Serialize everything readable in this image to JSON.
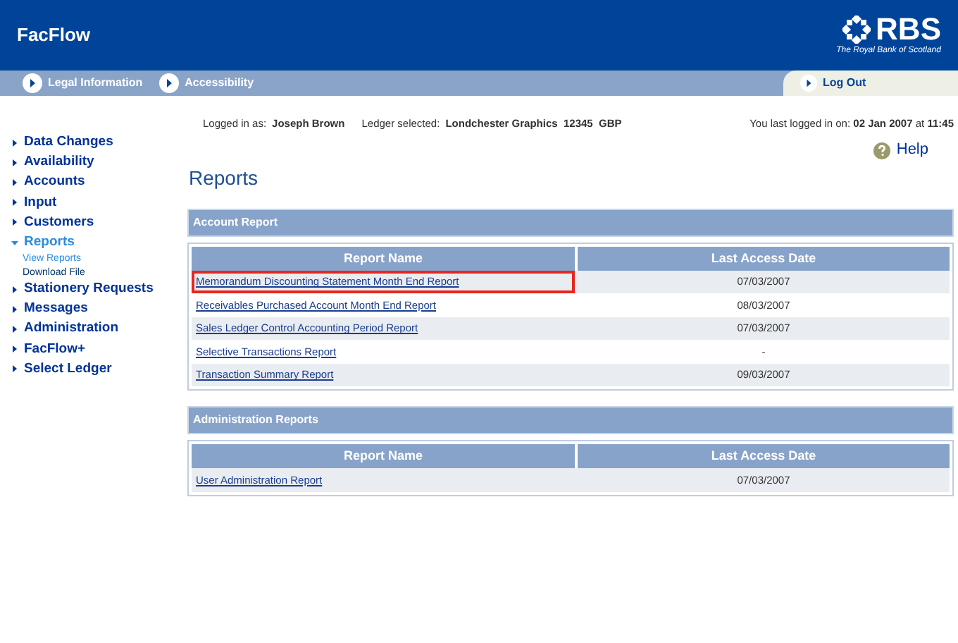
{
  "header": {
    "title": "FacFlow",
    "brand": {
      "name": "RBS",
      "tagline": "The Royal Bank of Scotland"
    }
  },
  "nav": {
    "links": [
      "Legal Information",
      "Accessibility"
    ],
    "logout": "Log Out"
  },
  "session": {
    "user_label": "Logged in as:",
    "user": "Joseph Brown",
    "ledger_label": "Ledger selected:",
    "ledger": "Londchester Graphics  12345  GBP",
    "last_login": "You last logged in on: **02 Jan 2007** at **11:45**"
  },
  "help": "Help",
  "sidebar": {
    "items": [
      {
        "label": "Data Changes",
        "expanded": false
      },
      {
        "label": "Availability",
        "expanded": false
      },
      {
        "label": "Accounts",
        "expanded": false
      },
      {
        "label": "Input",
        "expanded": false
      },
      {
        "label": "Customers",
        "expanded": false
      },
      {
        "label": "Reports",
        "expanded": true,
        "children": [
          {
            "label": "View Reports",
            "selected": true
          },
          {
            "label": "Download File",
            "selected": false
          }
        ]
      },
      {
        "label": "Stationery Requests",
        "expanded": false
      },
      {
        "label": "Messages",
        "expanded": false
      },
      {
        "label": "Administration",
        "expanded": false
      },
      {
        "label": "FacFlow+",
        "expanded": false
      },
      {
        "label": "Select Ledger",
        "expanded": false
      }
    ]
  },
  "page_title": "Reports",
  "sections": [
    {
      "title": "Account Report",
      "columns": [
        "Report Name",
        "Last Access Date"
      ],
      "rows": [
        {
          "name": "Memorandum Discounting Statement Month End Report",
          "date": "07/03/2007",
          "highlighted": true
        },
        {
          "name": "Receivables Purchased Account Month End Report",
          "date": "08/03/2007",
          "highlighted": false
        },
        {
          "name": "Sales Ledger Control Accounting Period Report",
          "date": "07/03/2007",
          "highlighted": false
        },
        {
          "name": "Selective Transactions Report",
          "date": "-",
          "highlighted": false
        },
        {
          "name": "Transaction Summary Report",
          "date": "09/03/2007",
          "highlighted": false
        }
      ]
    },
    {
      "title": "Administration Reports",
      "columns": [
        "Report Name",
        "Last Access Date"
      ],
      "rows": [
        {
          "name": "User Administration Report",
          "date": "07/03/2007",
          "highlighted": false
        }
      ]
    }
  ]
}
